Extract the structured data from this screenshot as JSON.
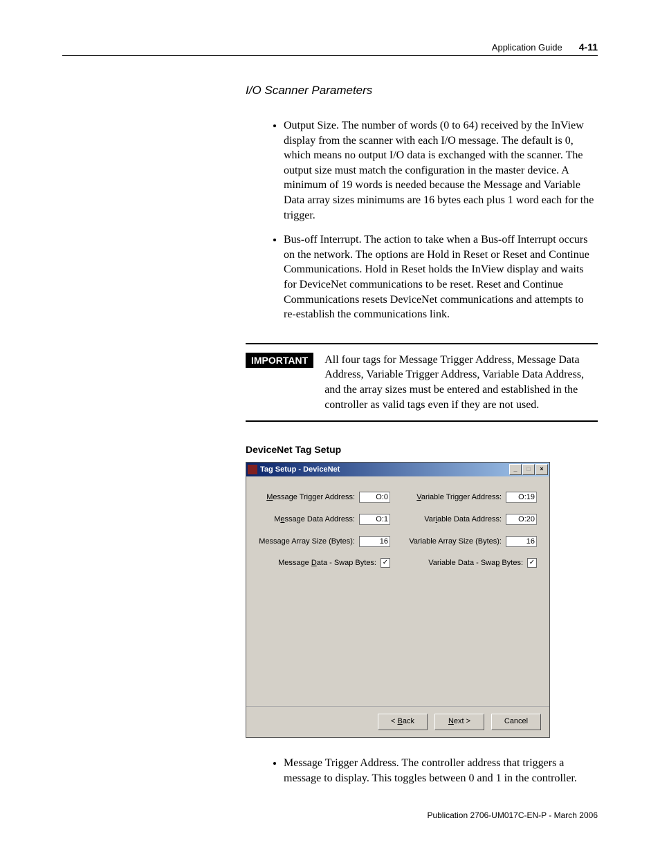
{
  "header": {
    "doc_title": "Application Guide",
    "page_number": "4-11"
  },
  "section_title": "I/O Scanner Parameters",
  "bullets_top": [
    "Output Size. The number of words (0 to 64) received by the InView display from the scanner with each I/O message. The default is 0, which means no output I/O data is exchanged with the scanner. The output size must match the configuration in the master device. A minimum of 19 words is needed because the Message and Variable Data array sizes minimums are 16 bytes each plus 1 word each for the trigger.",
    "Bus-off Interrupt. The action to take when a Bus-off Interrupt occurs on the network. The options are Hold in Reset or Reset and Continue Communications. Hold in Reset holds the InView display and waits for DeviceNet communications to be reset. Reset and Continue Communications resets DeviceNet communications and attempts to re-establish the communications link."
  ],
  "important": {
    "label": "IMPORTANT",
    "text": "All four tags for Message Trigger Address, Message Data Address, Variable Trigger Address, Variable Data Address, and the array sizes must be entered and established in the controller as valid tags even if they are not used."
  },
  "subsection_title": "DeviceNet Tag Setup",
  "dialog": {
    "title": "Tag Setup - DeviceNet",
    "fields": {
      "msg_trigger_label": "Message Trigger Address:",
      "msg_trigger_value": "O:0",
      "var_trigger_label": "Variable Trigger Address:",
      "var_trigger_value": "O:19",
      "msg_data_label": "Message Data Address:",
      "msg_data_value": "O:1",
      "var_data_label": "Variable Data Address:",
      "var_data_value": "O:20",
      "msg_array_label": "Message Array Size (Bytes):",
      "msg_array_value": "16",
      "var_array_label": "Variable Array Size (Bytes):",
      "var_array_value": "16",
      "msg_swap_label": "Message Data - Swap Bytes:",
      "msg_swap_checked": true,
      "var_swap_label": "Variable Data - Swap Bytes:",
      "var_swap_checked": true
    },
    "buttons": {
      "back": "< Back",
      "next": "Next >",
      "cancel": "Cancel"
    }
  },
  "bullets_bottom": [
    "Message Trigger Address. The controller address that triggers a message to display. This toggles between 0 and 1 in the controller."
  ],
  "footer": "Publication 2706-UM017C-EN-P - March 2006"
}
